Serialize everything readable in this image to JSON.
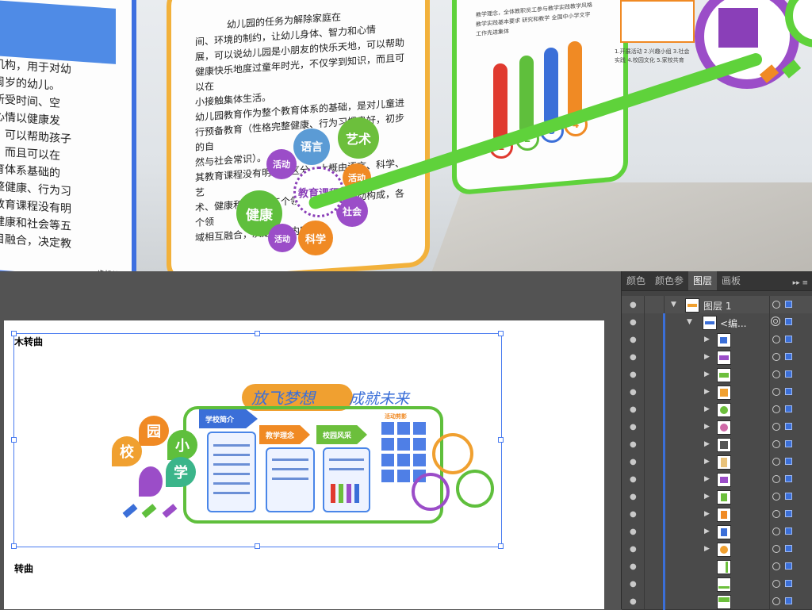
{
  "preview": {
    "left_panel_text": [
      "机构，用于对幼",
      "周岁的幼儿。",
      "所受时间、空",
      "心情以健康发",
      "，可以帮助孩子",
      "，而且可以在",
      "育体系基础的",
      "整健康、行为习",
      "教育课程没有明",
      "健康和社会等五",
      "目融合，决定教"
    ],
    "left_panel_footer": "一步推进",
    "mid_panel_text": [
      "幼儿园的任务为解除家庭在",
      "间、环境的制约，让幼儿身体、智力和心情",
      "展，可以说幼儿园是小朋友的快乐天地，可以帮助",
      "健康快乐地度过童年时光，不仅学到知识，而且可以在",
      "小接触集体生活。",
      "幼儿园教育作为整个教育体系的基础，是对儿童进",
      "行预备教育（性格完整健康、行为习惯良好，初步的自",
      "然与社会常识）。",
      "其教育课程没有明显的区分，大概由语言、科学、艺",
      "术、健康和社会等五个领域以及各种活动构成，各个领",
      "域相互融合，决定教学内容。"
    ],
    "bubbles": [
      "语言",
      "艺术",
      "活动",
      "健康",
      "活动",
      "社会",
      "活动",
      "科学"
    ],
    "center_bubble": "教育课程",
    "bar_numbers": [
      "1",
      "2",
      "3",
      "4"
    ]
  },
  "editor": {
    "label_top": "木转曲",
    "label_bottom": "转曲",
    "design": {
      "title_left": "放飞梦想",
      "title_right": "成就未来",
      "petal_chars": [
        "园",
        "校",
        "小",
        "学"
      ],
      "arrow_labels": [
        "学校简介",
        "教学理念",
        "校园风采"
      ],
      "section_label": "活动剪影"
    }
  },
  "layers_panel": {
    "tabs": [
      "颜色",
      "颜色参",
      "图层",
      "画板"
    ],
    "active_tab": "图层",
    "menu_glyph": "▸▸ ≡",
    "top_layer": "图层 1",
    "group_layer": "<编..."
  },
  "colors": {
    "selection": "#4a7cf0",
    "accent_blue": "#3b6fd8",
    "green": "#5fd23b",
    "orange": "#f2b13b",
    "purple": "#9b4dc8"
  }
}
